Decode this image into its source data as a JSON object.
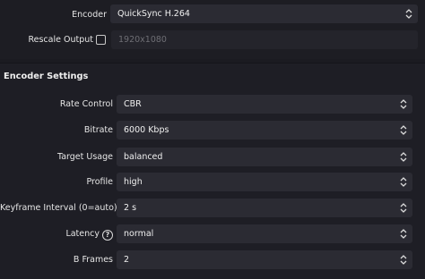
{
  "output": {
    "encoder_label": "Encoder",
    "encoder_value": "QuickSync H.264",
    "rescale_label": "Rescale Output",
    "rescale_checked": false,
    "rescale_value": "1920x1080"
  },
  "encoder_settings": {
    "title": "Encoder Settings",
    "rate_control_label": "Rate Control",
    "rate_control_value": "CBR",
    "bitrate_label": "Bitrate",
    "bitrate_value": "6000 Kbps",
    "target_usage_label": "Target Usage",
    "target_usage_value": "balanced",
    "profile_label": "Profile",
    "profile_value": "high",
    "keyframe_label": "Keyframe Interval (0=auto)",
    "keyframe_value": "2 s",
    "latency_label": "Latency",
    "latency_help": "?",
    "latency_value": "normal",
    "bframes_label": "B Frames",
    "bframes_value": "2"
  }
}
